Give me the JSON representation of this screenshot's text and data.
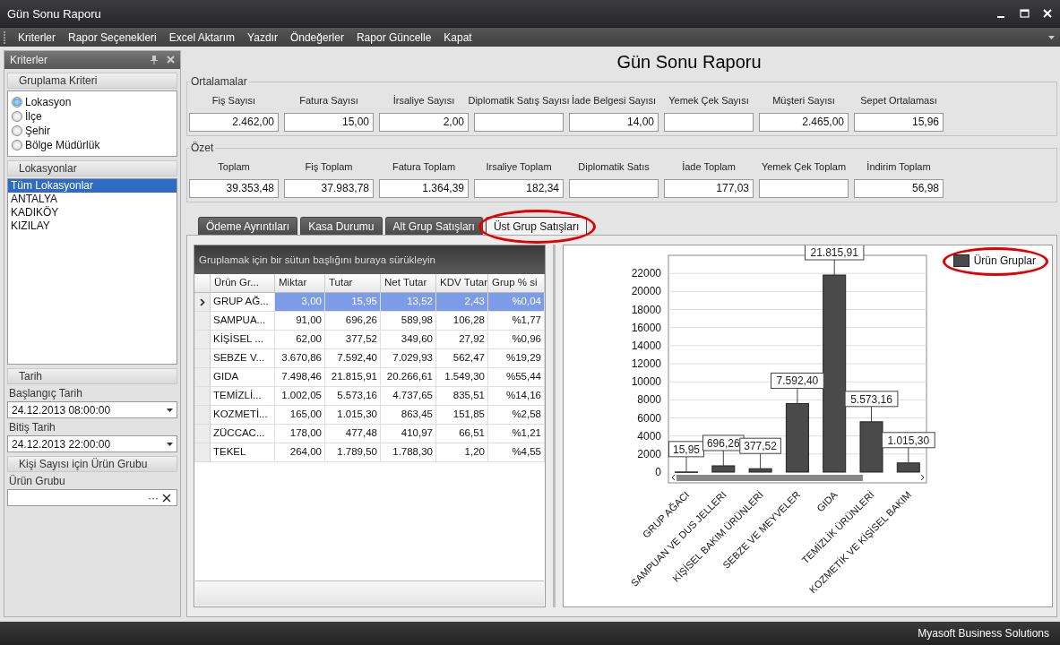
{
  "window": {
    "title": "Gün Sonu Raporu"
  },
  "menu": [
    "Kriterler",
    "Rapor Seçenekleri",
    "Excel Aktarım",
    "Yazdır",
    "Öndeğerler",
    "Rapor Güncelle",
    "Kapat"
  ],
  "sidebar": {
    "title": "Kriterler",
    "grouping": {
      "title": "Gruplama Kriteri",
      "options": [
        {
          "label": "Lokasyon",
          "selected": true
        },
        {
          "label": "İlçe",
          "selected": false
        },
        {
          "label": "Şehir",
          "selected": false
        },
        {
          "label": "Bölge Müdürlük",
          "selected": false
        }
      ]
    },
    "locations": {
      "title": "Lokasyonlar",
      "items": [
        {
          "label": "Tüm Lokasyonlar",
          "selected": true
        },
        {
          "label": "ANTALYA",
          "selected": false
        },
        {
          "label": "KADIKÖY",
          "selected": false
        },
        {
          "label": "KIZILAY",
          "selected": false
        }
      ]
    },
    "date": {
      "title": "Tarih",
      "start_label": "Başlangıç Tarih",
      "start": "24.12.2013 08:00:00",
      "end_label": "Bitiş Tarih",
      "end": "24.12.2013 22:00:00"
    },
    "product_group": {
      "title": "Kişi Sayısı için Ürün Grubu",
      "label": "Ürün Grubu",
      "ellipsis": "···"
    }
  },
  "report_title": "Gün Sonu Raporu",
  "averages": {
    "title": "Ortalamalar",
    "fields": [
      {
        "label": "Fiş Sayısı",
        "value": "2.462,00"
      },
      {
        "label": "Fatura Sayısı",
        "value": "15,00"
      },
      {
        "label": "İrsaliye Sayısı",
        "value": "2,00"
      },
      {
        "label": "Diplomatik Satış Sayısı"
      },
      {
        "label": "İade Belgesi Sayısı",
        "value": "14,00"
      },
      {
        "label": "Yemek Çek Sayısı"
      },
      {
        "label": "Müşteri Sayısı",
        "value": "2.465,00"
      },
      {
        "label": "Sepet Ortalaması",
        "value": "15,96"
      }
    ]
  },
  "summary": {
    "title": "Özet",
    "fields": [
      {
        "label": "Toplam",
        "value": "39.353,48"
      },
      {
        "label": "Fiş Toplam",
        "value": "37.983,78"
      },
      {
        "label": "Fatura Toplam",
        "value": "1.364,39"
      },
      {
        "label": "Irsaliye Toplam",
        "value": "182,34"
      },
      {
        "label": "Diplomatik Satıs"
      },
      {
        "label": "İade Toplam",
        "value": "177,03"
      },
      {
        "label": "Yemek Çek Toplam"
      },
      {
        "label": "İndirim Toplam",
        "value": "56,98"
      }
    ]
  },
  "tabs": [
    {
      "label": "Ödeme Ayrıntıları",
      "selected": false,
      "highlighted": false
    },
    {
      "label": "Kasa Durumu",
      "selected": false,
      "highlighted": false
    },
    {
      "label": "Alt Grup Satışları",
      "selected": false,
      "highlighted": false
    },
    {
      "label": "Üst Grup Satışları",
      "selected": true,
      "highlighted": true
    }
  ],
  "table": {
    "group_hint": "Gruplamak için bir sütun başlığını buraya sürükleyin",
    "columns": [
      "Ürün Gr...",
      "Miktar",
      "Tutar",
      "Net Tutar",
      "KDV Tutar",
      "Grup % si"
    ],
    "rows": [
      {
        "selected": true,
        "cells": [
          "GRUP AĞ...",
          "3,00",
          "15,95",
          "13,52",
          "2,43",
          "%0,04"
        ]
      },
      {
        "selected": false,
        "cells": [
          "SAMPUA...",
          "91,00",
          "696,26",
          "589,98",
          "106,28",
          "%1,77"
        ]
      },
      {
        "selected": false,
        "cells": [
          "KİŞİSEL ...",
          "62,00",
          "377,52",
          "349,60",
          "27,92",
          "%0,96"
        ]
      },
      {
        "selected": false,
        "cells": [
          "SEBZE V...",
          "3.670,86",
          "7.592,40",
          "7.029,93",
          "562,47",
          "%19,29"
        ]
      },
      {
        "selected": false,
        "cells": [
          "GIDA",
          "7.498,46",
          "21.815,91",
          "20.266,61",
          "1.549,30",
          "%55,44"
        ]
      },
      {
        "selected": false,
        "cells": [
          "TEMİZLİ...",
          "1.002,05",
          "5.573,16",
          "4.737,65",
          "835,51",
          "%14,16"
        ]
      },
      {
        "selected": false,
        "cells": [
          "KOZMETİ...",
          "165,00",
          "1.015,30",
          "863,45",
          "151,85",
          "%2,58"
        ]
      },
      {
        "selected": false,
        "cells": [
          "ZÜCCAC...",
          "178,00",
          "477,48",
          "410,97",
          "66,51",
          "%1,21"
        ]
      },
      {
        "selected": false,
        "cells": [
          "TEKEL",
          "264,00",
          "1.789,50",
          "1.788,30",
          "1,20",
          "%4,55"
        ]
      }
    ]
  },
  "chart": {
    "legend_highlighted": true,
    "chart_data": {
      "type": "bar",
      "categories": [
        "GRUP AĞACI",
        "SAMPUAN VE DUS JELLERI",
        "KİŞİSEL BAKIM ÜRÜNLERİ",
        "SEBZE VE MEYVELER",
        "GIDA",
        "TEMİZLİK ÜRÜNLERİ",
        "KOZMETİK VE KİŞİSEL BAKIM"
      ],
      "series": [
        {
          "name": "Ürün Gruplar",
          "color": "#4a4a4a",
          "values": [
            16,
            696,
            378,
            7592,
            21816,
            5573,
            1015
          ]
        }
      ],
      "grid": true,
      "value_labels": [
        "15,95",
        "696,26",
        "377,52",
        "7.592,40",
        "21.815,91",
        "5.573,16",
        "1.015,30"
      ],
      "ylim": [
        0,
        24000
      ],
      "yticks": [
        0,
        2000,
        4000,
        6000,
        8000,
        10000,
        12000,
        14000,
        16000,
        18000,
        20000,
        22000
      ]
    }
  },
  "status_bar": "Myasoft Business Solutions"
}
